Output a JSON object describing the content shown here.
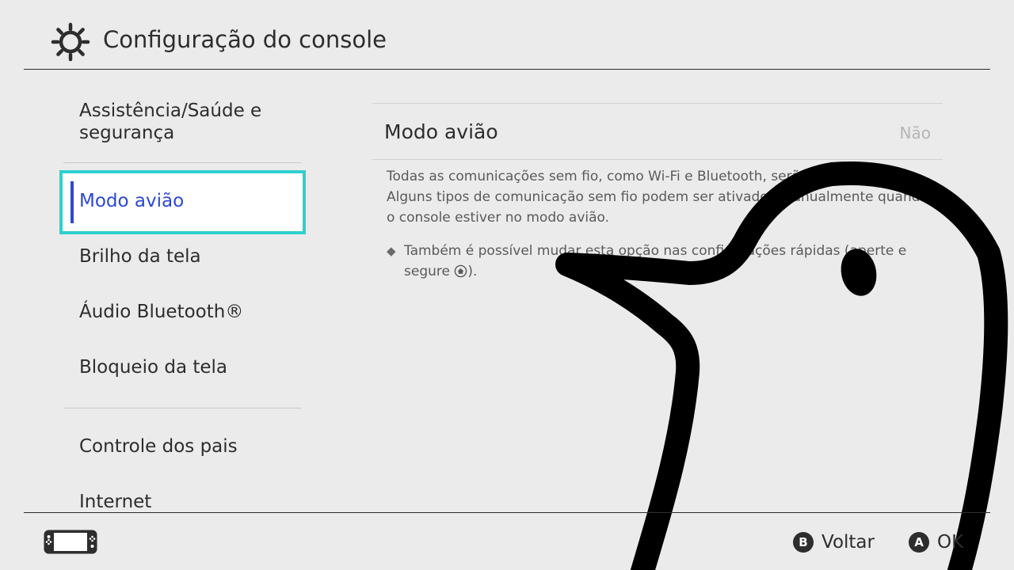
{
  "header": {
    "title": "Configuração do console",
    "icon": "gear-icon"
  },
  "sidebar": {
    "items": [
      {
        "label": "Assistência/Saúde e segurança",
        "line1": "Assistência/Saúde e",
        "line2": "segurança"
      },
      {
        "label": "Modo avião",
        "selected": true
      },
      {
        "label": "Brilho da tela"
      },
      {
        "label": "Áudio Bluetooth®"
      },
      {
        "label": "Bloqueio da tela"
      },
      {
        "label": "Controle dos pais"
      },
      {
        "label": "Internet"
      }
    ]
  },
  "main": {
    "setting_title": "Modo avião",
    "setting_value": "Não",
    "description": "Todas as comunicações sem fio, como Wi-Fi e Bluetooth, serão desativadas. Alguns tipos de comunicação sem fio podem ser ativados manualmente quando o console estiver no modo avião.",
    "note_text": "Também é possível mudar esta opção nas configurações rápidas (aperte e segure ",
    "note_end": ").",
    "note_icon": "home-button-icon"
  },
  "footer": {
    "console_icon": "handheld-console-icon",
    "back": {
      "key": "B",
      "label": "Voltar"
    },
    "ok": {
      "key": "A",
      "label": "OK"
    }
  },
  "colors": {
    "background": "#ebebeb",
    "selection_border": "#2fcfd0",
    "selected_text": "#2b48d8",
    "value_text": "#b5b5b5"
  }
}
